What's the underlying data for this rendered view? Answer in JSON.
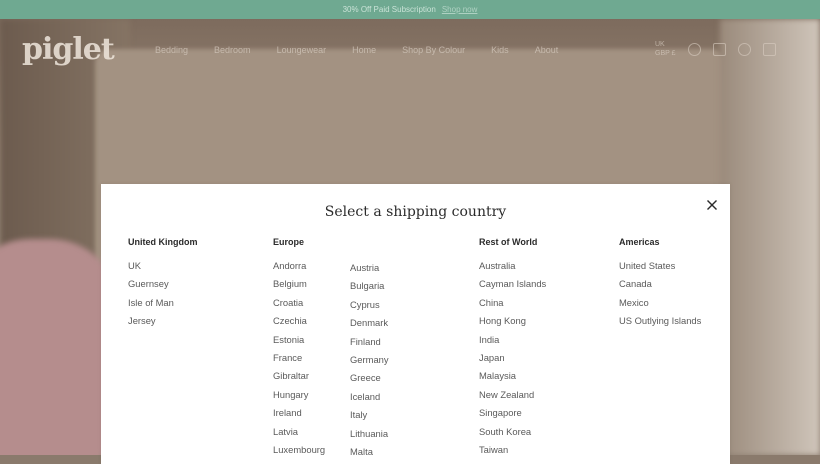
{
  "announcement": {
    "text": "30% Off Paid Subscription",
    "link": "Shop now"
  },
  "brand": {
    "logo": "piglet"
  },
  "nav": {
    "links": [
      "Bedding",
      "Bedroom",
      "Loungewear",
      "Home",
      "Shop By Colour",
      "Kids",
      "About"
    ],
    "currency": "GBP £",
    "region": "UK"
  },
  "modal": {
    "title": "Select a shipping country",
    "close_label": "×",
    "uk": {
      "heading": "United Kingdom",
      "items": [
        "UK",
        "Guernsey",
        "Isle of Man",
        "Jersey"
      ]
    },
    "europe": {
      "heading": "Europe",
      "col1": [
        "Andorra",
        "Belgium",
        "Croatia",
        "Czechia",
        "Estonia",
        "France",
        "Gibraltar",
        "Hungary",
        "Ireland",
        "Latvia",
        "Luxembourg"
      ],
      "col2": [
        "Austria",
        "Bulgaria",
        "Cyprus",
        "Denmark",
        "Finland",
        "Germany",
        "Greece",
        "Iceland",
        "Italy",
        "Lithuania",
        "Malta"
      ]
    },
    "rest": {
      "heading": "Rest of World",
      "items": [
        "Australia",
        "Cayman Islands",
        "China",
        "Hong Kong",
        "India",
        "Japan",
        "Malaysia",
        "New Zealand",
        "Singapore",
        "South Korea",
        "Taiwan"
      ]
    },
    "americas": {
      "heading": "Americas",
      "items": [
        "United States",
        "Canada",
        "Mexico",
        "US Outlying Islands"
      ]
    }
  },
  "colors": {
    "announcement_bg": "#6fa991",
    "modal_bg": "#ffffff",
    "text_dark": "#2b2b2b",
    "text_muted": "#5a5a5a"
  }
}
